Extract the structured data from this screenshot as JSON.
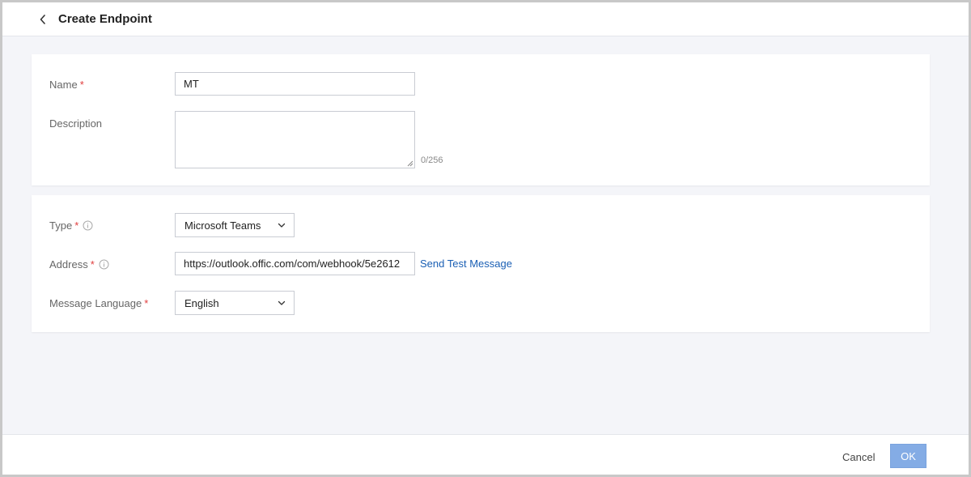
{
  "header": {
    "title": "Create Endpoint",
    "back_icon": "chevron-left-icon"
  },
  "basic": {
    "name_label": "Name",
    "name_value": "MT",
    "description_label": "Description",
    "description_value": "",
    "description_count": "0/256"
  },
  "config": {
    "type_label": "Type",
    "type_value": "Microsoft Teams",
    "address_label": "Address",
    "address_value": "https://outlook.offic.com/com/webhook/5e2612",
    "send_test_label": "Send Test Message",
    "language_label": "Message Language",
    "language_value": "English"
  },
  "footer": {
    "cancel_label": "Cancel",
    "ok_label": "OK"
  },
  "colors": {
    "required": "#e03d3d",
    "link": "#1a5fb4",
    "primary_disabled": "#84ace5",
    "background": "#f4f5f9"
  }
}
